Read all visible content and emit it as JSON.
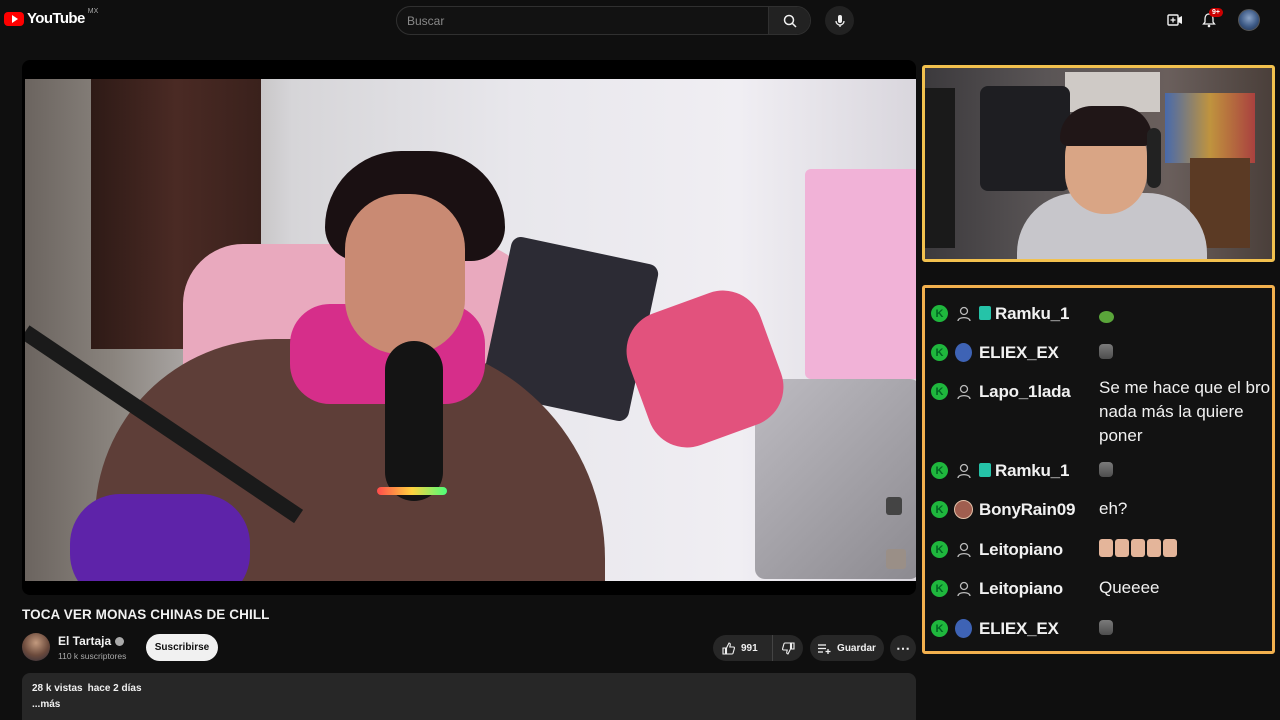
{
  "header": {
    "logo_text": "YouTube",
    "region": "MX",
    "search_placeholder": "Buscar",
    "notification_count": "9+"
  },
  "video": {
    "title": "TOCA VER MONAS CHINAS DE CHILL",
    "channel_name": "El Tartaja",
    "subscribers": "110 k suscriptores",
    "subscribe_label": "Suscribirse",
    "likes": "991",
    "save_label": "Guardar",
    "views": "28 k vistas",
    "time_ago": "hace 2 días",
    "more_label": "...más"
  },
  "chat": {
    "messages": [
      {
        "user": "Ramku_1",
        "text": "",
        "emote": "frog-emote",
        "badge": "gift"
      },
      {
        "user": "ELIEX_EX",
        "text": "",
        "emote": "face-emote",
        "badge": "avatar"
      },
      {
        "user": "Lapo_1lada",
        "text": "Se me hace que el bro nada más la quiere poner",
        "emote": "",
        "badge": "none"
      },
      {
        "user": "Ramku_1",
        "text": "",
        "emote": "face-emote",
        "badge": "gift"
      },
      {
        "user": "BonyRain09",
        "text": "eh?",
        "emote": "",
        "badge": "avatar"
      },
      {
        "user": "Leitopiano",
        "text": "",
        "emote": "face-strip-emote",
        "badge": "none"
      },
      {
        "user": "Leitopiano",
        "text": "Queeee",
        "emote": "",
        "badge": "none"
      },
      {
        "user": "ELIEX_EX",
        "text": "",
        "emote": "face-emote",
        "badge": "avatar"
      }
    ]
  },
  "colors": {
    "webcam_border": "#f2c14e",
    "chat_border": "#f2b04e",
    "badge_green": "#1fb73d",
    "brand_red": "#ff0000"
  }
}
